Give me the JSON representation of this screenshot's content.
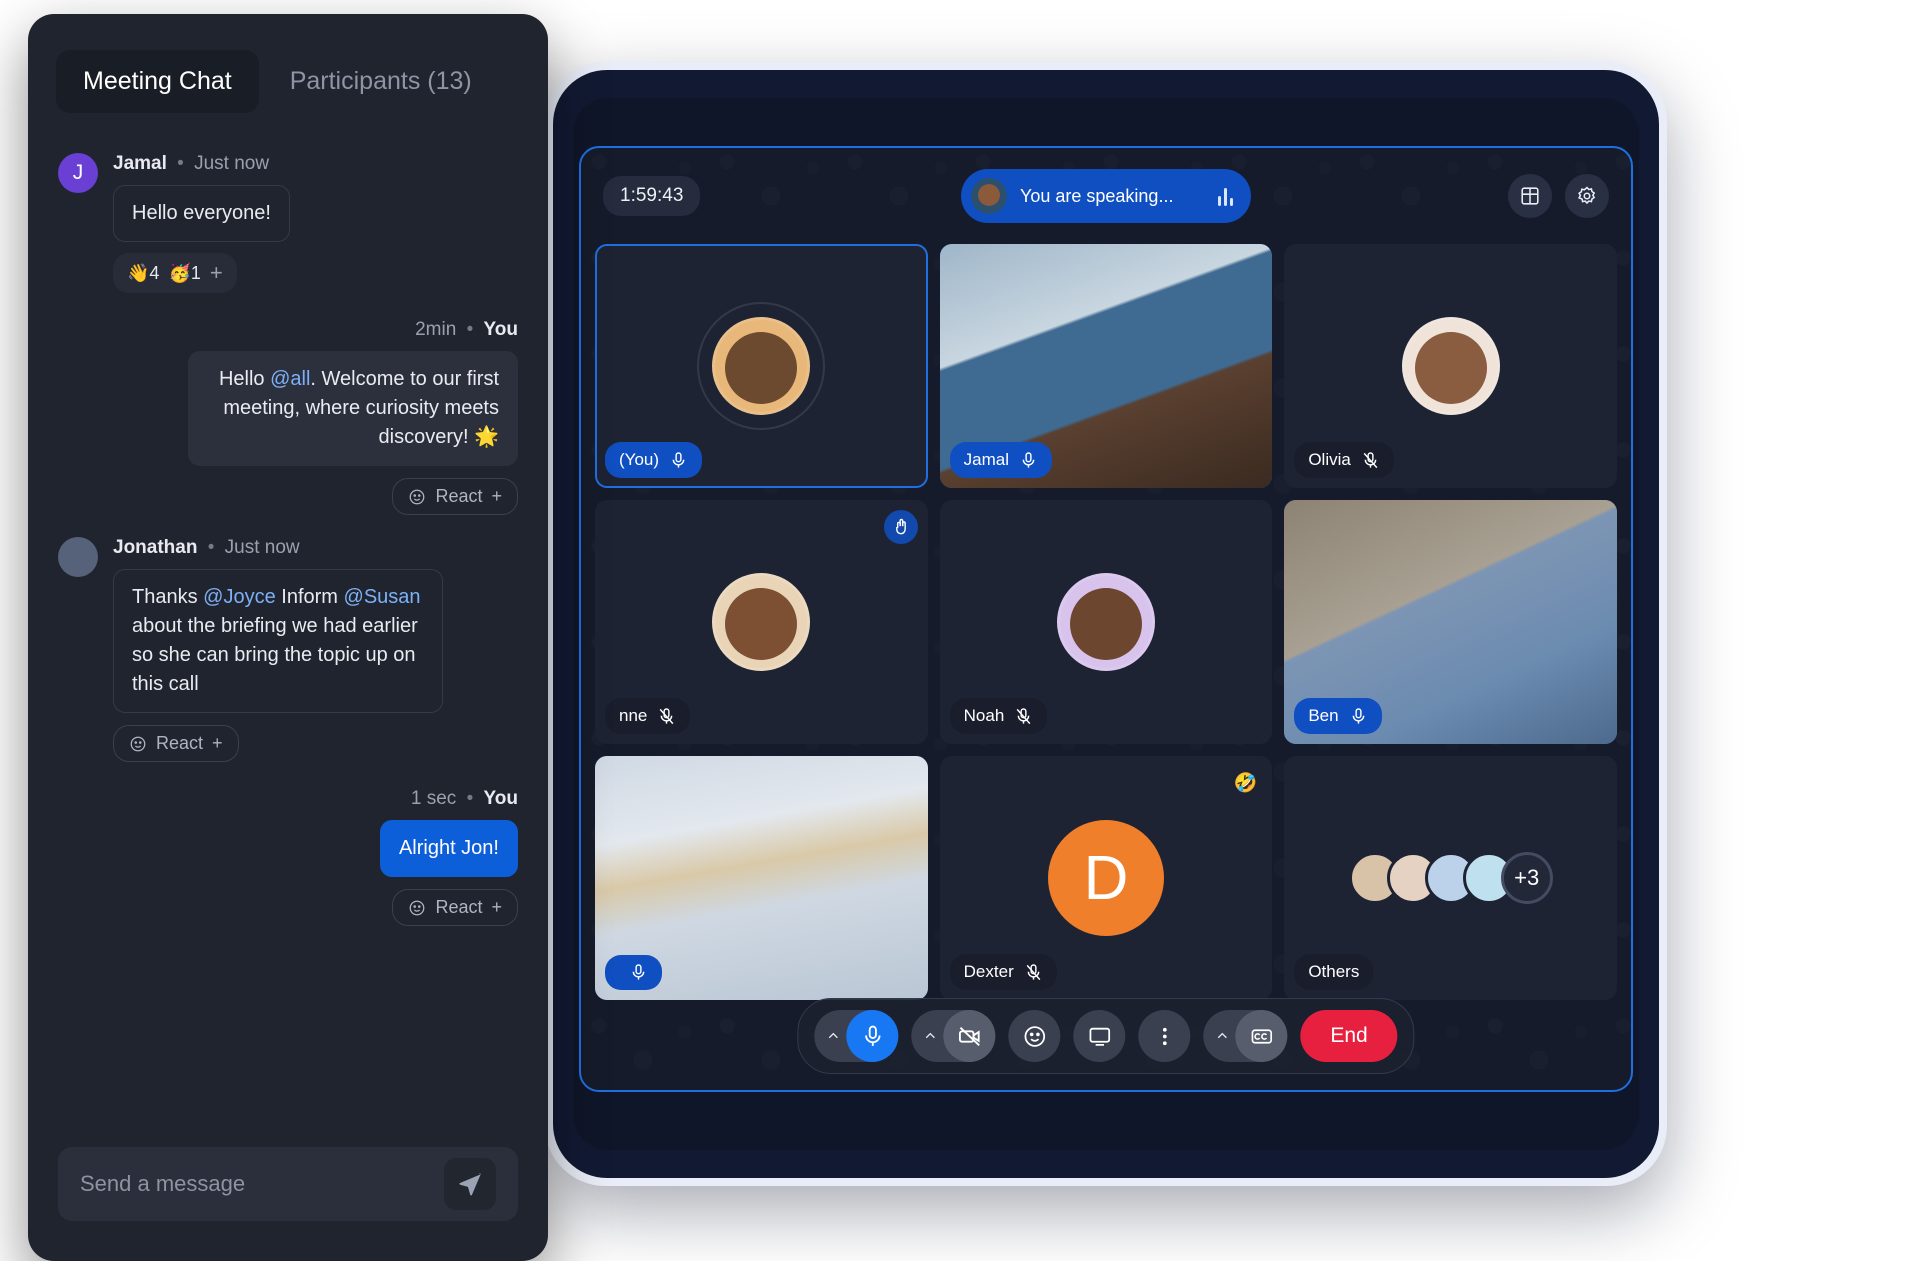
{
  "chat": {
    "tabs": [
      {
        "label": "Meeting Chat",
        "active": true
      },
      {
        "label": "Participants (13)",
        "active": false
      }
    ],
    "messages": [
      {
        "sender": "Jamal",
        "time": "Just now",
        "separator": "•",
        "avatar_initial": "J",
        "avatar_color": "#6a3fd4",
        "text": "Hello everyone!",
        "reactions": [
          {
            "emoji": "👋",
            "count": "4"
          },
          {
            "emoji": "🥳",
            "count": "1"
          }
        ],
        "add_reaction": "+"
      },
      {
        "sender": "You",
        "time": "2min",
        "separator": "•",
        "text_parts": [
          {
            "t": "Hello ",
            "mention": false
          },
          {
            "t": "@all",
            "mention": true
          },
          {
            "t": ". Welcome to our first meeting, where curiosity meets discovery! 🌟",
            "mention": false
          }
        ],
        "react_label": "React",
        "react_plus": "+"
      },
      {
        "sender": "Jonathan",
        "time": "Just now",
        "separator": "•",
        "text_parts": [
          {
            "t": "Thanks ",
            "mention": false
          },
          {
            "t": "@Joyce",
            "mention": true
          },
          {
            "t": " Inform ",
            "mention": false
          },
          {
            "t": "@Susan",
            "mention": true
          },
          {
            "t": " about the briefing we had earlier so she can bring the topic up on this call",
            "mention": false
          }
        ],
        "react_label": "React",
        "react_plus": "+"
      },
      {
        "sender": "You",
        "time": "1 sec",
        "separator": "•",
        "text": "Alright Jon!",
        "react_label": "React",
        "react_plus": "+"
      }
    ],
    "composer": {
      "placeholder": "Send a message",
      "value": "",
      "send_icon": "send-icon"
    }
  },
  "call": {
    "timer": "1:59:43",
    "speaking": {
      "text": "You are speaking...",
      "avatar": "speaking-avatar",
      "equalizer_icon": "audio-level-icon"
    },
    "topbar_buttons": [
      {
        "icon": "grid-layout-icon",
        "name": "layout-button"
      },
      {
        "icon": "gear-icon",
        "name": "settings-button"
      }
    ],
    "tiles": [
      {
        "name": "(You)",
        "muted": false,
        "kind": "avatar",
        "avatar_color": "#e8b87a",
        "reaction": ""
      },
      {
        "name": "Jamal",
        "muted": false,
        "kind": "video",
        "reaction": ""
      },
      {
        "name": "Olivia",
        "muted": true,
        "kind": "avatar",
        "avatar_color": "#f0e3da",
        "reaction": ""
      },
      {
        "name": "nne",
        "muted": true,
        "kind": "avatar",
        "avatar_color": "#e9d4b8",
        "reaction": "raise-hand"
      },
      {
        "name": "Noah",
        "muted": true,
        "kind": "avatar",
        "avatar_color": "#d8c3ec",
        "reaction": ""
      },
      {
        "name": "Ben",
        "muted": false,
        "kind": "video",
        "reaction": ""
      },
      {
        "name": "",
        "muted": false,
        "kind": "video",
        "reaction": ""
      },
      {
        "name": "Dexter",
        "muted": true,
        "kind": "initial",
        "initial": "D",
        "avatar_color": "#ef7f2a",
        "reaction": "🤣"
      },
      {
        "name": "Others",
        "muted": null,
        "kind": "stack",
        "more_count": "+3",
        "reaction": ""
      }
    ],
    "controls": [
      {
        "name": "microphone-button",
        "icon": "mic-icon",
        "state": "active",
        "caret": true
      },
      {
        "name": "camera-button",
        "icon": "camera-off-icon",
        "state": "off",
        "caret": true
      },
      {
        "name": "reactions-button",
        "icon": "emoji-icon",
        "state": "default",
        "caret": false
      },
      {
        "name": "share-screen-button",
        "icon": "screen-share-icon",
        "state": "default",
        "caret": false
      },
      {
        "name": "more-options-button",
        "icon": "more-vertical-icon",
        "state": "default",
        "caret": false
      },
      {
        "name": "captions-button",
        "icon": "closed-captions-icon",
        "state": "off",
        "caret": true
      }
    ],
    "end_label": "End"
  },
  "colors": {
    "accent_blue": "#0f4fc2",
    "control_blue": "#1877f2",
    "bubble_blue": "#0d5fd9",
    "end_red": "#e8203f",
    "dexter_orange": "#ef7f2a",
    "mention_blue": "#7eb0f5"
  }
}
